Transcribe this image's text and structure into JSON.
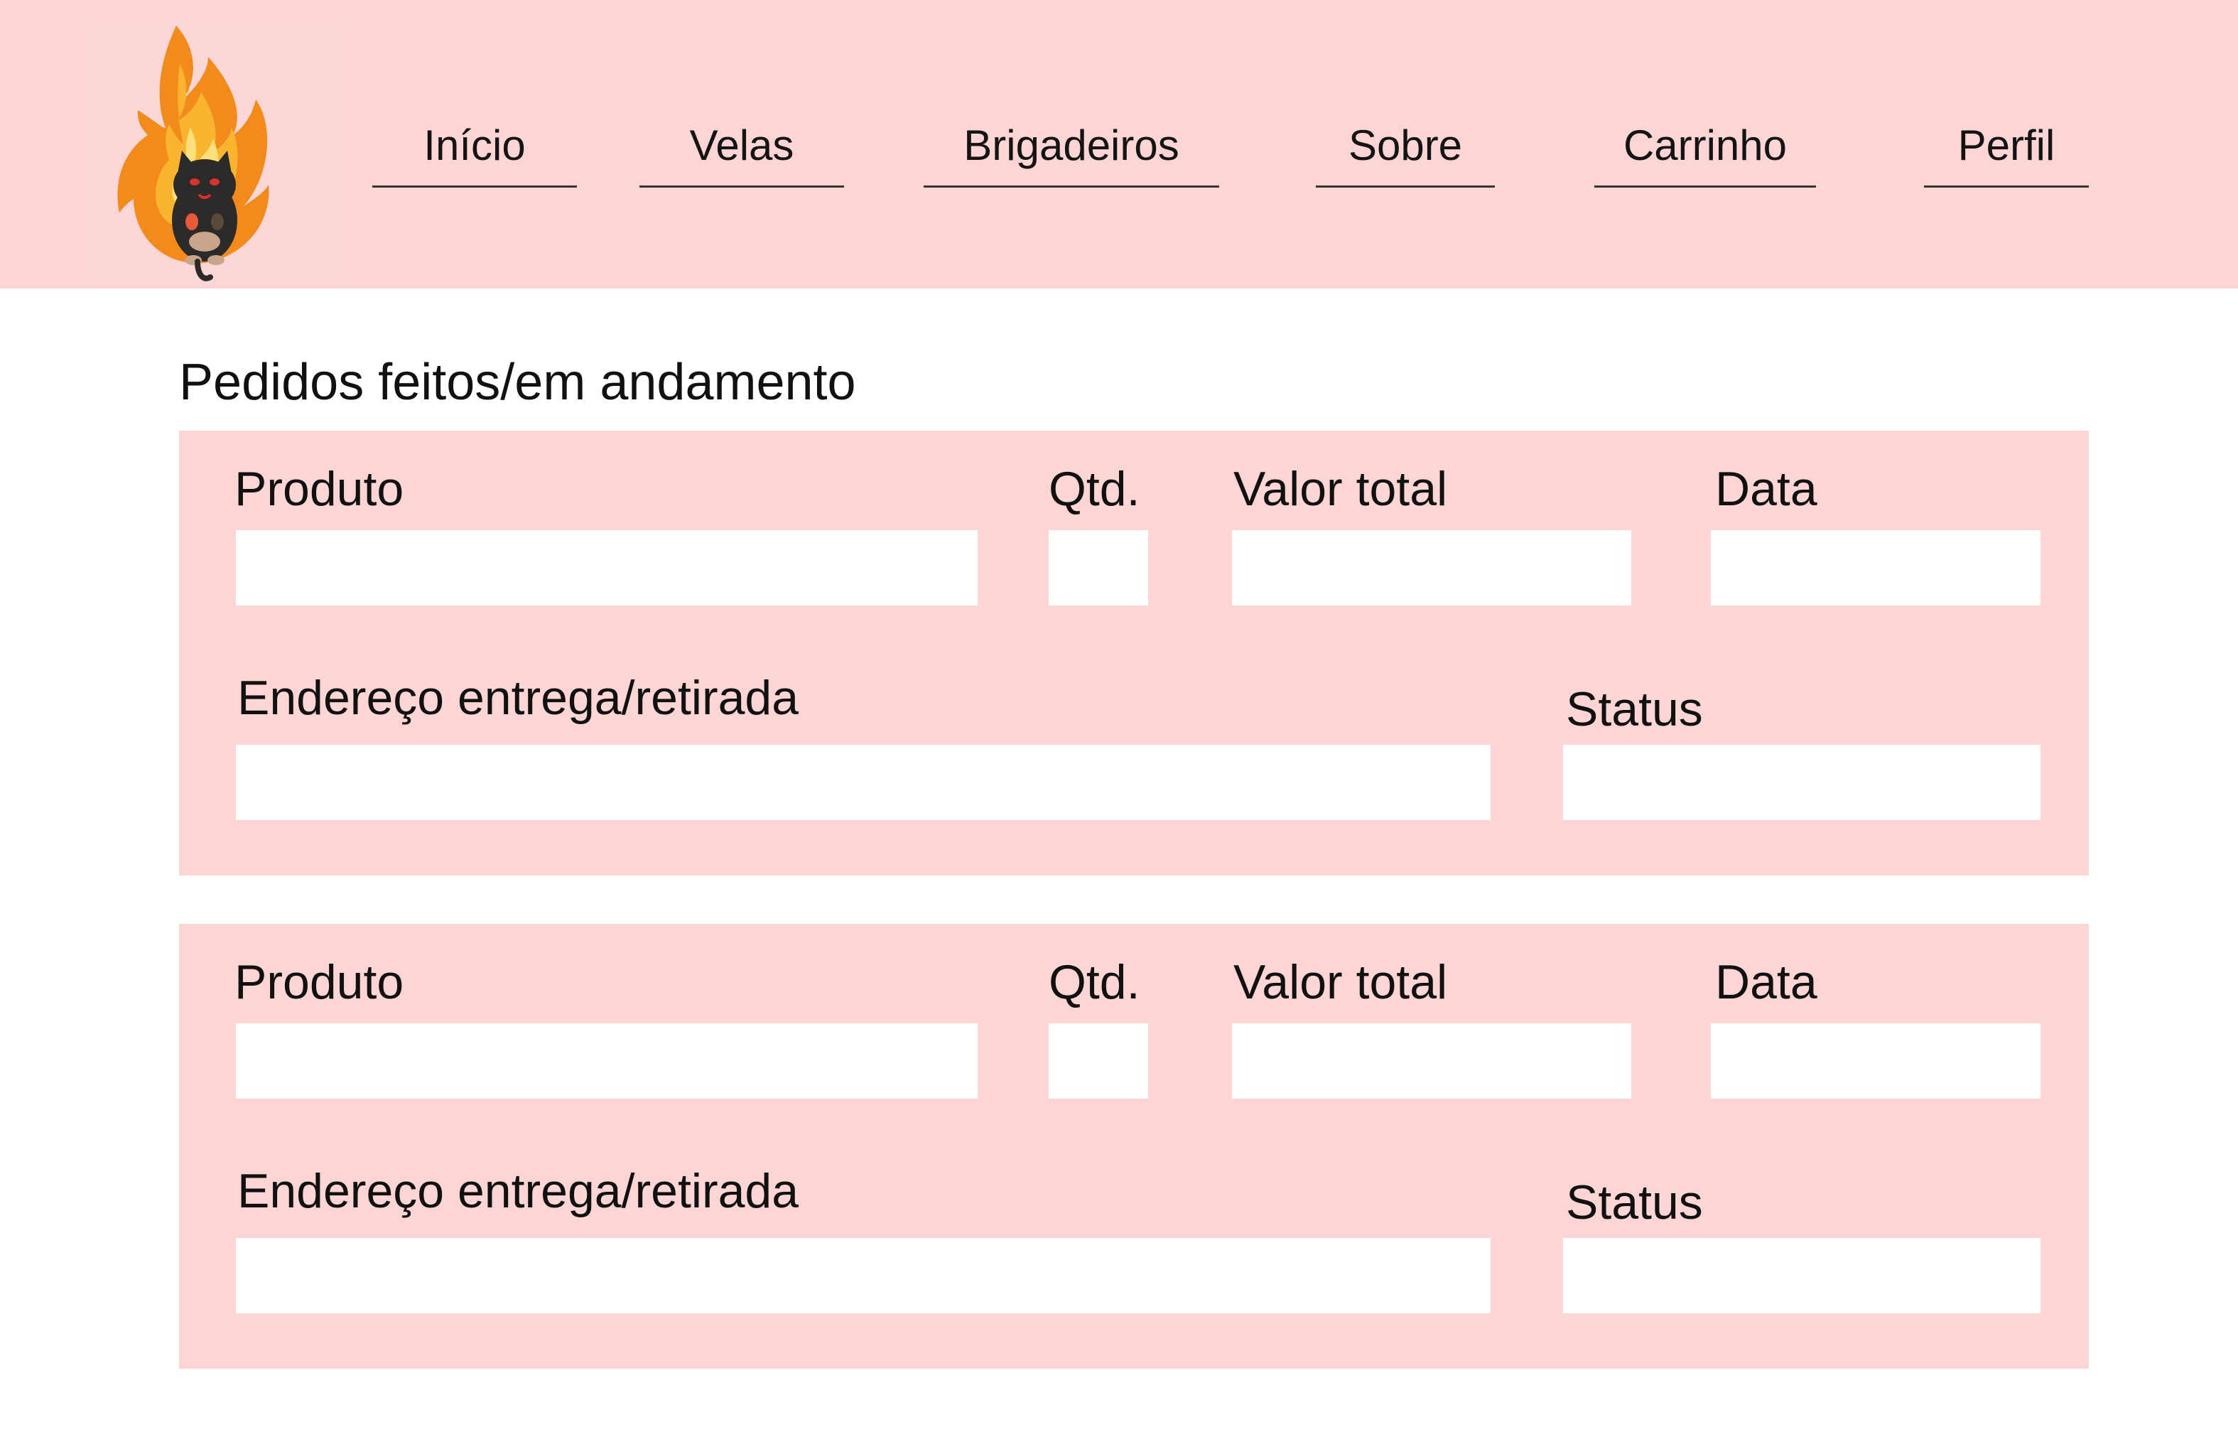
{
  "nav": {
    "items": [
      {
        "label": "Início"
      },
      {
        "label": "Velas"
      },
      {
        "label": "Brigadeiros"
      },
      {
        "label": "Sobre"
      },
      {
        "label": "Carrinho"
      },
      {
        "label": "Perfil"
      }
    ]
  },
  "logo": {
    "icon": "flaming-black-cat-logo"
  },
  "page": {
    "title": "Pedidos feitos/em andamento"
  },
  "orders": [
    {
      "labels": {
        "produto": "Produto",
        "qtd": "Qtd.",
        "valor_total": "Valor total",
        "data": "Data",
        "endereco": "Endereço entrega/retirada",
        "status": "Status"
      },
      "values": {
        "produto": "",
        "qtd": "",
        "valor_total": "",
        "data": "",
        "endereco": "",
        "status": ""
      }
    },
    {
      "labels": {
        "produto": "Produto",
        "qtd": "Qtd.",
        "valor_total": "Valor total",
        "data": "Data",
        "endereco": "Endereço entrega/retirada",
        "status": "Status"
      },
      "values": {
        "produto": "",
        "qtd": "",
        "valor_total": "",
        "data": "",
        "endereco": "",
        "status": ""
      }
    }
  ],
  "colors": {
    "header_bg": "#fed5d5",
    "card_bg": "#fed5d5",
    "field_bg": "#ffffff",
    "text": "#111111"
  }
}
